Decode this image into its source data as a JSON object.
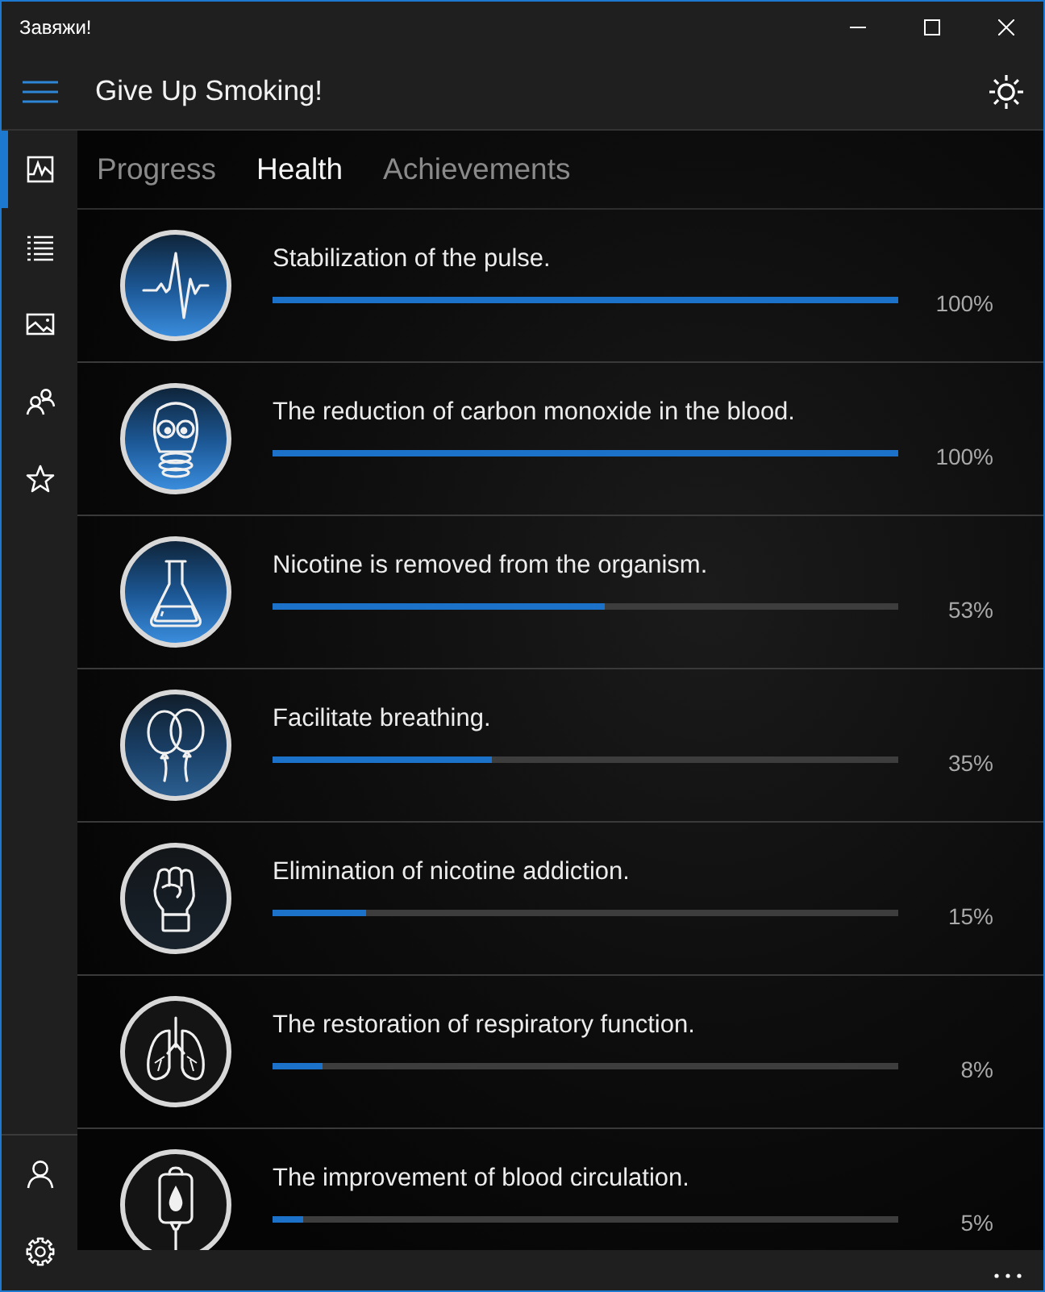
{
  "window": {
    "title": "Завяжи!"
  },
  "header": {
    "title": "Give Up Smoking!"
  },
  "sidebar": {
    "items": [
      {
        "selected": true
      },
      {
        "selected": false
      },
      {
        "selected": false
      },
      {
        "selected": false
      },
      {
        "selected": false
      }
    ]
  },
  "tabs": [
    {
      "label": "Progress",
      "selected": false
    },
    {
      "label": "Health",
      "selected": true
    },
    {
      "label": "Achievements",
      "selected": false
    }
  ],
  "health_items": [
    {
      "title": "Stabilization of the pulse.",
      "level": 1,
      "reading": "100%"
    },
    {
      "title": "The reduction of carbon monoxide in the blood.",
      "level": 1,
      "reading": "100%"
    },
    {
      "title": "Nicotine is removed from the organism.",
      "level": 0.53,
      "reading": "53%"
    },
    {
      "title": "Facilitate breathing.",
      "level": 0.35,
      "reading": "35%"
    },
    {
      "title": "Elimination of nicotine addiction.",
      "level": 0.15,
      "reading": "15%"
    },
    {
      "title": "The restoration of respiratory function.",
      "level": 0.08,
      "reading": "8%"
    },
    {
      "title": "The improvement of blood circulation.",
      "level": 0.05,
      "reading": "5%"
    }
  ]
}
